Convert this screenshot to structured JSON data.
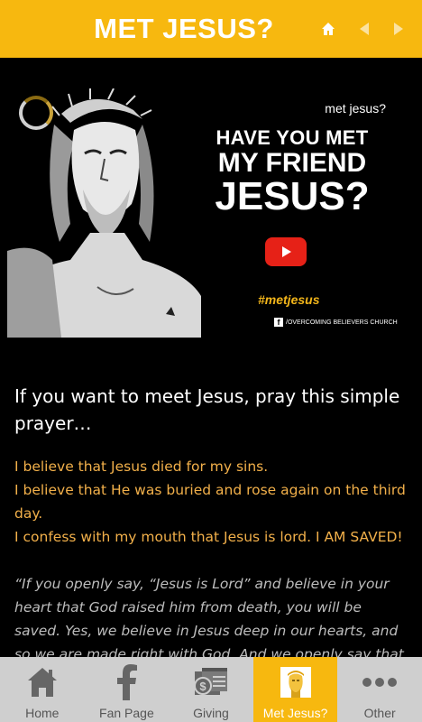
{
  "header": {
    "title": "MET JESUS?",
    "home_icon": "home-icon",
    "back_icon": "arrow-left-icon",
    "forward_icon": "arrow-right-icon",
    "accent_color": "#f7b80f"
  },
  "video": {
    "tag": "met jesus?",
    "headline_line1": "HAVE YOU MET",
    "headline_line2": "MY FRIEND",
    "headline_line3": "JESUS?",
    "hashtag": "#metjesus",
    "facebook_text": "/OVERCOMING BELIEVERS CHURCH",
    "play_icon": "youtube-play-icon"
  },
  "content": {
    "intro": "If you want to meet Jesus, pray this simple prayer…",
    "prayer_lines": [
      "I believe that Jesus died for my sins.",
      "I believe that He was buried and rose again on the third day.",
      "I confess with my mouth that Jesus is lord. I AM SAVED!"
    ],
    "verse": "“If you openly say, “Jesus is Lord” and believe in your heart that God raised him from death, you will be saved. Yes, we believe in Jesus deep in our hearts, and so we are made right with God. And we openly say that we believe in him"
  },
  "tabs": [
    {
      "label": "Home",
      "icon": "home-icon",
      "active": false
    },
    {
      "label": "Fan Page",
      "icon": "facebook-icon",
      "active": false
    },
    {
      "label": "Giving",
      "icon": "giving-icon",
      "active": false
    },
    {
      "label": "Met Jesus?",
      "icon": "jesus-icon",
      "active": true
    },
    {
      "label": "Other",
      "icon": "more-icon",
      "active": false
    }
  ]
}
